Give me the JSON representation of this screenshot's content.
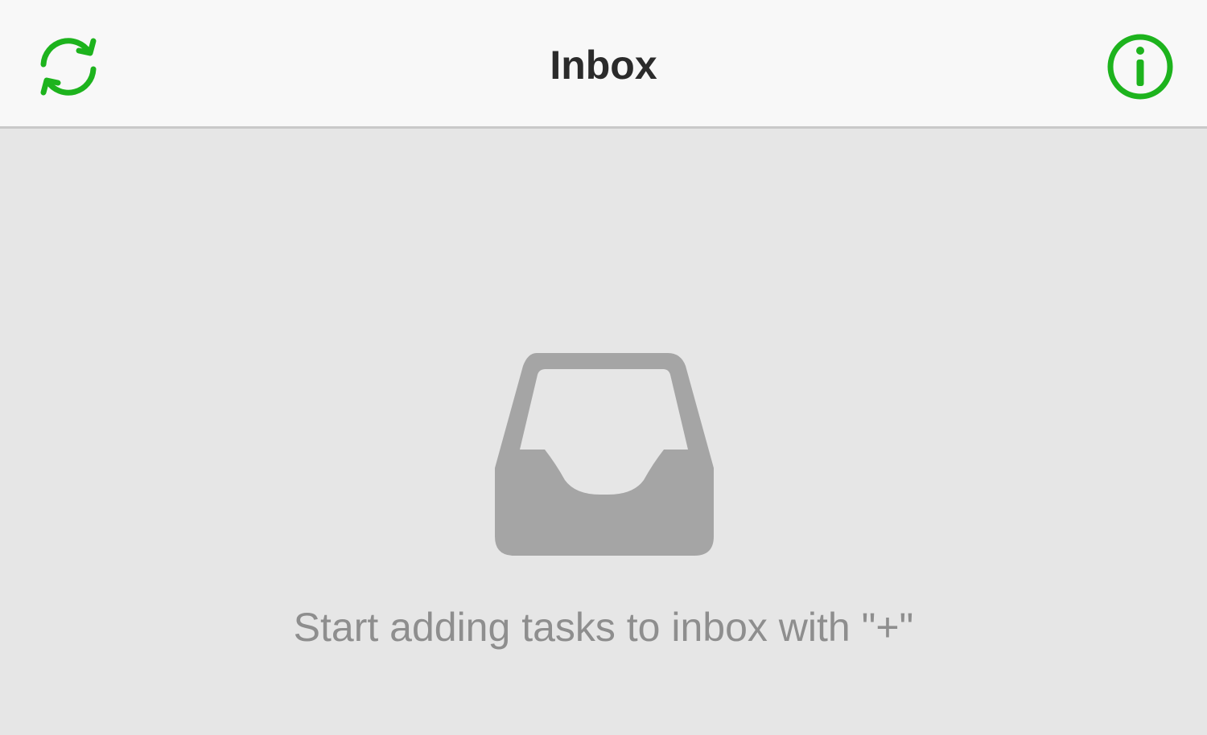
{
  "navbar": {
    "title": "Inbox",
    "left_icon": "sync-icon",
    "right_icon": "info-icon",
    "accent_color": "#1db31d"
  },
  "empty_state": {
    "icon": "inbox-tray-icon",
    "message": "Start adding tasks to inbox with \"+\""
  }
}
